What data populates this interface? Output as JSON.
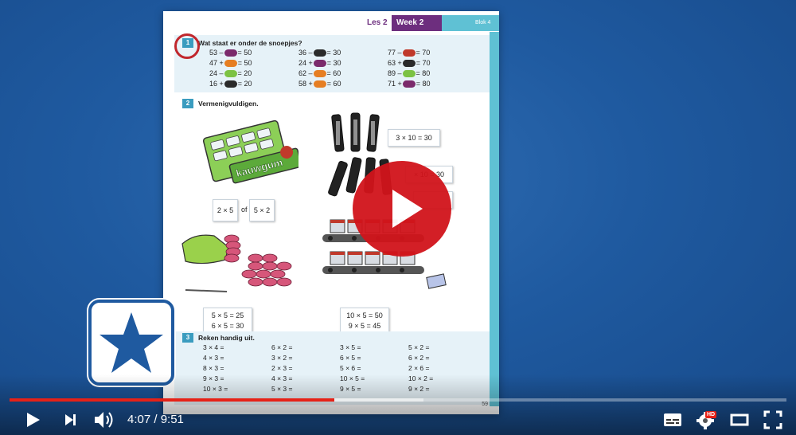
{
  "player": {
    "current_time": "4:07",
    "duration": "9:51",
    "time_display": "4:07 / 9:51",
    "progress_fraction": 0.418,
    "buffered_fraction": 0.533,
    "hd_label": "HD",
    "colors": {
      "progress": "#e62117",
      "play_button": "#d1141b",
      "background": "#1f5aa0"
    }
  },
  "icons": {
    "play": "play-icon",
    "next": "next-icon",
    "volume": "volume-icon",
    "subtitles": "subtitles-icon",
    "settings": "gear-icon",
    "theater": "theater-mode-icon",
    "fullscreen": "fullscreen-icon",
    "big_play": "big-play-icon",
    "logo": "star-icon"
  },
  "workbook": {
    "les": "Les 2",
    "week": "Week 2",
    "blok": "Blok 4",
    "page_number": "59",
    "section1": {
      "number": "1",
      "title": "Wat staat er onder de snoepjes?",
      "equations": [
        {
          "left": "53 –",
          "candy": "#7b2a6b",
          "right": "= 50"
        },
        {
          "left": "36 –",
          "candy": "#2a2a2a",
          "right": "= 30"
        },
        {
          "left": "77 –",
          "candy": "#c0392b",
          "right": "= 70"
        },
        {
          "left": "47 +",
          "candy": "#e67e22",
          "right": "= 50"
        },
        {
          "left": "24 +",
          "candy": "#7b2a6b",
          "right": "= 30"
        },
        {
          "left": "63 +",
          "candy": "#2a2a2a",
          "right": "= 70"
        },
        {
          "left": "24 –",
          "candy": "#7cc243",
          "right": "= 20"
        },
        {
          "left": "62 –",
          "candy": "#e67e22",
          "right": "= 60"
        },
        {
          "left": "89 –",
          "candy": "#7cc243",
          "right": "= 80"
        },
        {
          "left": "16 +",
          "candy": "#2a2a2a",
          "right": "= 20"
        },
        {
          "left": "58 +",
          "candy": "#e67e22",
          "right": "= 60"
        },
        {
          "left": "71 +",
          "candy": "#7b2a6b",
          "right": "= 80"
        }
      ]
    },
    "section2": {
      "number": "2",
      "title": "Vermenigvuldigen.",
      "gum_label": "kauwgum",
      "box_2x5": "2 × 5",
      "of_label": "of",
      "box_5x2": "5 × 2",
      "box_3x10": "3 × 10 = 30",
      "box_x10": "× 10 = 30",
      "box_5x5": "5 × 5 = 25",
      "box_6x5": "6 × 5 = 30",
      "box_10x5": "10 × 5 = 50",
      "box_9x5": "9 × 5 = 45"
    },
    "section3": {
      "number": "3",
      "title": "Reken handig uit.",
      "items": [
        "3 × 4 =",
        "6 × 2 =",
        "3 × 5 =",
        "5 × 2 =",
        "4 × 3 =",
        "3 × 2 =",
        "6 × 5 =",
        "6 × 2 =",
        "8 × 3 =",
        "2 × 3 =",
        "5 × 6 =",
        "2 × 6 =",
        "9 × 3 =",
        "4 × 3 =",
        "10 × 5 =",
        "10 × 2 =",
        "10 × 3 =",
        "5 × 3 =",
        "9 × 5 =",
        "9 × 2 ="
      ]
    }
  }
}
